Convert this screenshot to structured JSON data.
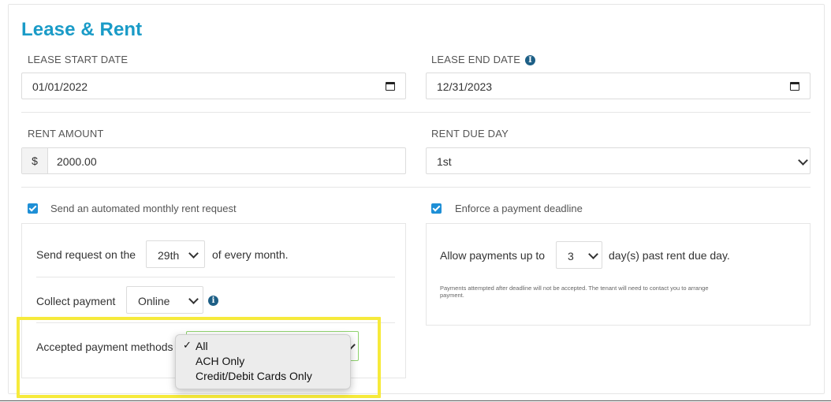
{
  "section_title": "Lease & Rent",
  "lease": {
    "start_label": "LEASE START DATE",
    "start_value": "01/01/2022",
    "end_label": "LEASE END DATE",
    "end_value": "12/31/2023"
  },
  "rent": {
    "amount_label": "RENT AMOUNT",
    "currency_symbol": "$",
    "amount_value": "2000.00",
    "due_day_label": "RENT DUE DAY",
    "due_day_value": "1st"
  },
  "auto_request": {
    "checkbox_label": "Send an automated monthly rent request",
    "checked": true,
    "send_on_prefix": "Send request on the",
    "send_on_day": "29th",
    "send_on_suffix": "of every month.",
    "collect_label": "Collect payment",
    "collect_value": "Online",
    "methods_label": "Accepted payment methods"
  },
  "deadline": {
    "checkbox_label": "Enforce a payment deadline",
    "checked": true,
    "allow_prefix": "Allow payments up to",
    "allow_days": "3",
    "allow_suffix": "day(s) past rent due day.",
    "note_line1": "Payments attempted after deadline will not be accepted. The tenant will need to contact you to arrange",
    "note_line2": "payment."
  },
  "methods_dropdown": {
    "selected_mark": "✓",
    "options": [
      "All",
      "ACH Only",
      "Credit/Debit Cards Only"
    ]
  },
  "colors": {
    "title": "#1a9bc7",
    "checkbox": "#1e8fd6",
    "info_icon": "#1d5f86",
    "highlight": "#f6ea3b",
    "focus_border": "#8fd36e"
  }
}
